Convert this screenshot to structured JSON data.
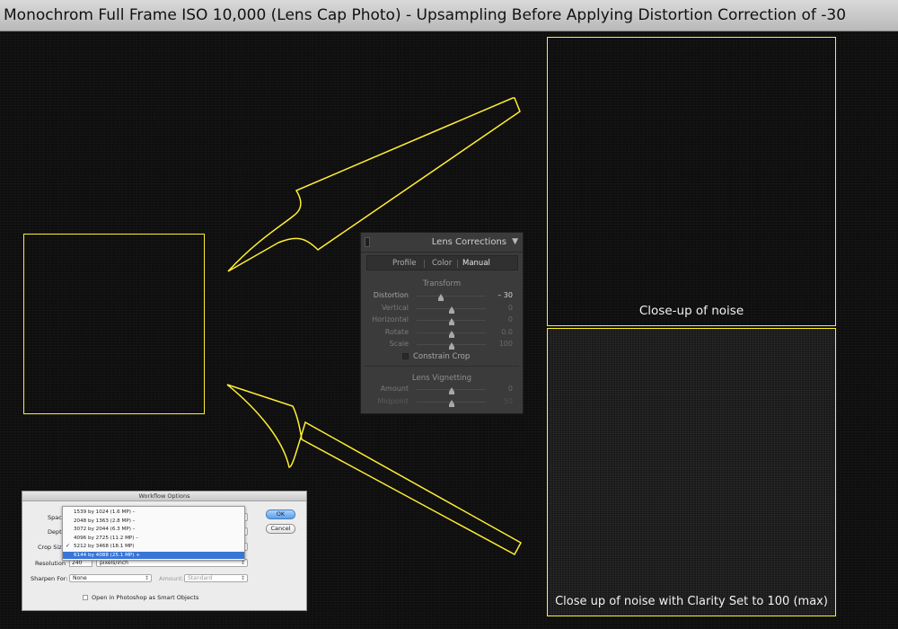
{
  "title": "Monochrom Full Frame ISO 10,000 (Lens Cap Photo) - Upsampling Before Applying Distortion Correction of -30",
  "captions": {
    "top": "Close-up of noise",
    "bottom": "Close up of noise with Clarity Set to 100 (max)"
  },
  "colors": {
    "outline": "#ffee33",
    "background": "#0e0e0e"
  },
  "lens_panel": {
    "title": "Lens Corrections",
    "collapse_icon": "▼",
    "tabs": [
      {
        "label": "Profile"
      },
      {
        "label": "Color"
      },
      {
        "label": "Manual"
      }
    ],
    "active_tab": "Manual",
    "transform": {
      "label": "Transform",
      "sliders": [
        {
          "label": "Distortion",
          "value": "– 30",
          "position": 0.35
        },
        {
          "label": "Vertical",
          "value": "0",
          "position": 0.5
        },
        {
          "label": "Horizontal",
          "value": "0",
          "position": 0.5
        },
        {
          "label": "Rotate",
          "value": "0.0",
          "position": 0.5
        },
        {
          "label": "Scale",
          "value": "100",
          "position": 0.5
        }
      ],
      "constrain_crop": "Constrain Crop"
    },
    "vignetting": {
      "label": "Lens Vignetting",
      "sliders": [
        {
          "label": "Amount",
          "value": "0",
          "position": 0.5
        },
        {
          "label": "Midpoint",
          "value": "50",
          "position": 0.5
        }
      ]
    }
  },
  "workflow_dialog": {
    "title": "Workflow Options",
    "labels": {
      "space": "Space",
      "depth": "Depth",
      "crop_size": "Crop Size",
      "resolution": "Resolution",
      "sharpen_for": "Sharpen For:",
      "amount": "Amount:"
    },
    "resolution_value": "240",
    "resolution_units": "pixels/inch",
    "sharpen_value": "None",
    "amount_value": "Standard",
    "smart_objects": "Open in Photoshop as Smart Objects",
    "ok": "OK",
    "cancel": "Cancel",
    "crop_size_options": [
      "1539 by 1024  (1.6 MP)  –",
      "2048 by 1363  (2.8 MP)  –",
      "3072 by 2044  (6.3 MP)  –",
      "4096 by 2725  (11.2 MP)  –",
      "5212 by 3468  (18.1 MP)",
      "6144 by 4088  (25.1 MP)  +"
    ],
    "checked_option_index": 4,
    "highlighted_option_index": 5
  }
}
